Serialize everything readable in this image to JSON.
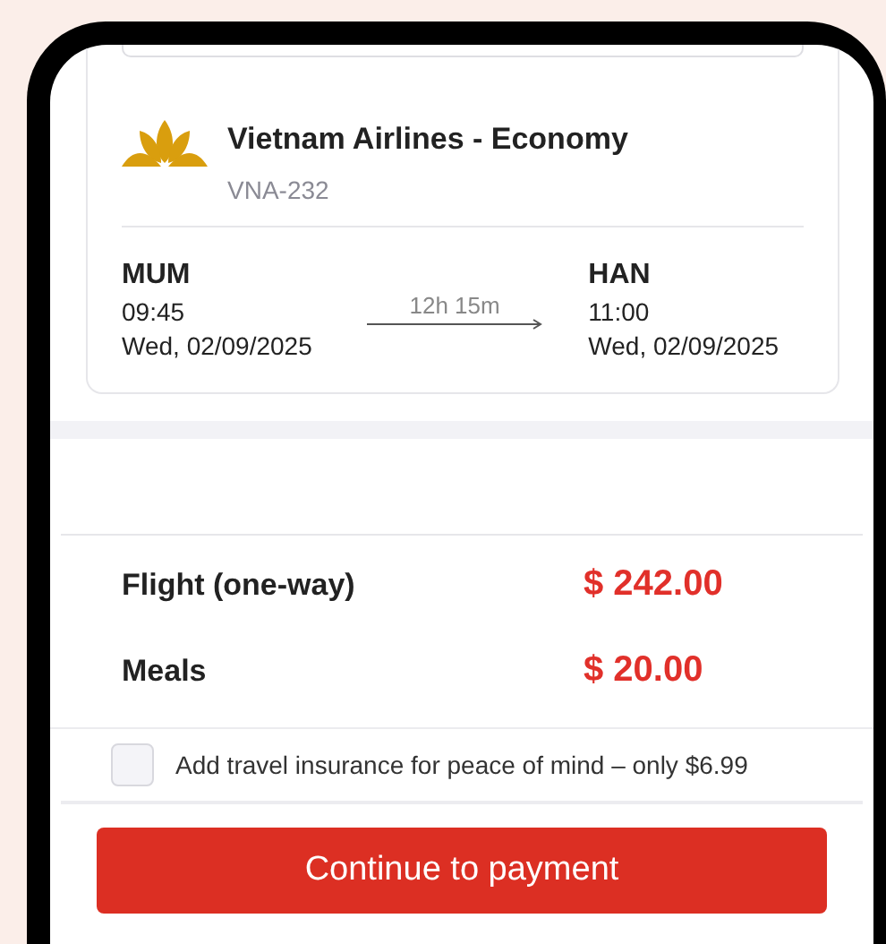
{
  "flight": {
    "airline": "Vietnam Airlines - Economy",
    "code": "VNA-232",
    "departure": {
      "airport": "MUM",
      "time": "09:45",
      "date": "Wed, 02/09/2025"
    },
    "duration": "12h 15m",
    "arrival": {
      "airport": "HAN",
      "time": "11:00",
      "date": "Wed, 02/09/2025"
    }
  },
  "prices": [
    {
      "label": "Flight (one-way)",
      "amount": "$ 242.00"
    },
    {
      "label": "Meals",
      "amount": "$ 20.00"
    }
  ],
  "insurance": {
    "label": "Add travel insurance for peace of mind – only $6.99",
    "checked": false
  },
  "button": "Continue to payment"
}
